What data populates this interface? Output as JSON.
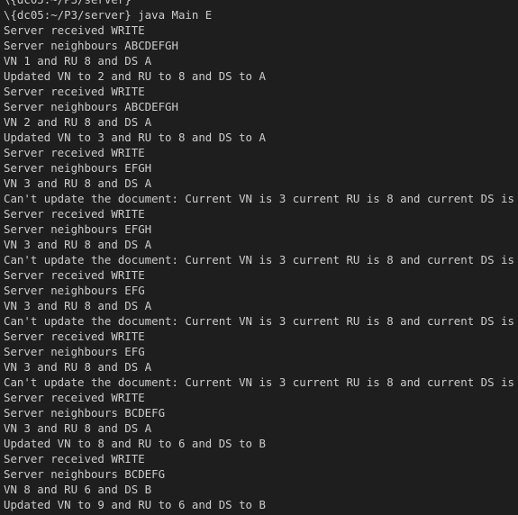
{
  "terminal": {
    "partial_top": "\\{dc05:~/P3/server}",
    "prompt": "\\{dc05:~/P3/server} java Main E",
    "lines": [
      "Server received WRITE",
      "Server neighbours ABCDEFGH",
      "VN 1 and RU 8 and DS A",
      "Updated VN to 2 and RU to 8 and DS to A",
      "Server received WRITE",
      "Server neighbours ABCDEFGH",
      "VN 2 and RU 8 and DS A",
      "Updated VN to 3 and RU to 8 and DS to A",
      "Server received WRITE",
      "Server neighbours EFGH",
      "VN 3 and RU 8 and DS A",
      "Can't update the document: Current VN is 3 current RU is 8 and current DS is A",
      "Server received WRITE",
      "Server neighbours EFGH",
      "VN 3 and RU 8 and DS A",
      "Can't update the document: Current VN is 3 current RU is 8 and current DS is A",
      "Server received WRITE",
      "Server neighbours EFG",
      "VN 3 and RU 8 and DS A",
      "Can't update the document: Current VN is 3 current RU is 8 and current DS is A",
      "Server received WRITE",
      "Server neighbours EFG",
      "VN 3 and RU 8 and DS A",
      "Can't update the document: Current VN is 3 current RU is 8 and current DS is A",
      "Server received WRITE",
      "Server neighbours BCDEFG",
      "VN 3 and RU 8 and DS A",
      "Updated VN to 8 and RU to 6 and DS to B",
      "Server received WRITE",
      "Server neighbours BCDEFG",
      "VN 8 and RU 6 and DS B",
      "Updated VN to 9 and RU to 6 and DS to B"
    ],
    "colors": {
      "background": "#1e1e1e",
      "foreground": "#cccccc"
    }
  }
}
